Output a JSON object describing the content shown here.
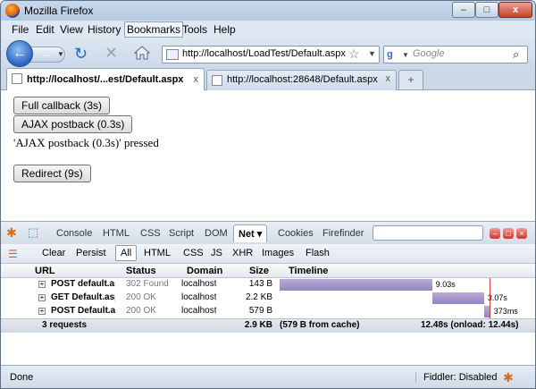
{
  "window": {
    "title": "Mozilla Firefox",
    "min_glyph": "–",
    "max_glyph": "□",
    "close_glyph": "x"
  },
  "menu": [
    "File",
    "Edit",
    "View",
    "History",
    "Bookmarks",
    "Tools",
    "Help"
  ],
  "navbar": {
    "back_glyph": "←",
    "forward_glyph": "→",
    "dropdown_glyph": "▼",
    "reload_glyph": "↻",
    "stop_glyph": "✕",
    "url": "http://localhost/LoadTest/Default.aspx",
    "star_glyph": "☆",
    "search_engine": "g",
    "search_placeholder": "Google",
    "search_glyph": "⌕"
  },
  "tabs": [
    {
      "label": "http://localhost/...est/Default.aspx",
      "selected": true
    },
    {
      "label": "http://localhost:28648/Default.aspx",
      "selected": false
    }
  ],
  "tab_close_glyph": "x",
  "newtab_glyph": "+",
  "page": {
    "full_callback": "Full callback (3s)",
    "ajax_postback": "AJAX postback (0.3s)",
    "status_message": "'AJAX postback (0.3s)' pressed",
    "redirect": "Redirect (9s)"
  },
  "firebug": {
    "tabs": [
      "Console",
      "HTML",
      "CSS",
      "Script",
      "DOM",
      "Net ▾",
      "Cookies",
      "Firefinder"
    ],
    "selected_tab": "Net ▾",
    "subtoolbar": [
      "Clear",
      "Persist",
      "All",
      "HTML",
      "CSS",
      "JS",
      "XHR",
      "Images",
      "Flash"
    ],
    "selected_filter": "All",
    "columns": {
      "url": "URL",
      "status": "Status",
      "domain": "Domain",
      "size": "Size",
      "timeline": "Timeline"
    },
    "requests": [
      {
        "method_url": "POST default.as",
        "status": "302 Found",
        "domain": "localhost",
        "size": "143 B",
        "time": "9.03s",
        "start": 0.0,
        "duration": 9.03
      },
      {
        "method_url": "GET Default.asp",
        "status": "200 OK",
        "domain": "localhost",
        "size": "2.2 KB",
        "time": "3.07s",
        "start": 9.03,
        "duration": 3.07
      },
      {
        "method_url": "POST Default.a",
        "status": "200 OK",
        "domain": "localhost",
        "size": "579 B",
        "time": "373ms",
        "start": 12.1,
        "duration": 0.37
      }
    ],
    "summary": {
      "requests": "3 requests",
      "size": "2.9 KB",
      "cache": "(579 B from cache)",
      "time": "12.48s (onload: 12.44s)"
    },
    "total_seconds": 12.48
  },
  "statusbar": {
    "left": "Done",
    "fiddler": "Fiddler: Disabled"
  },
  "colors": {
    "bar": "#9d8fc8",
    "redline": "#d23c3c",
    "blueline": "#4a6ed8"
  }
}
